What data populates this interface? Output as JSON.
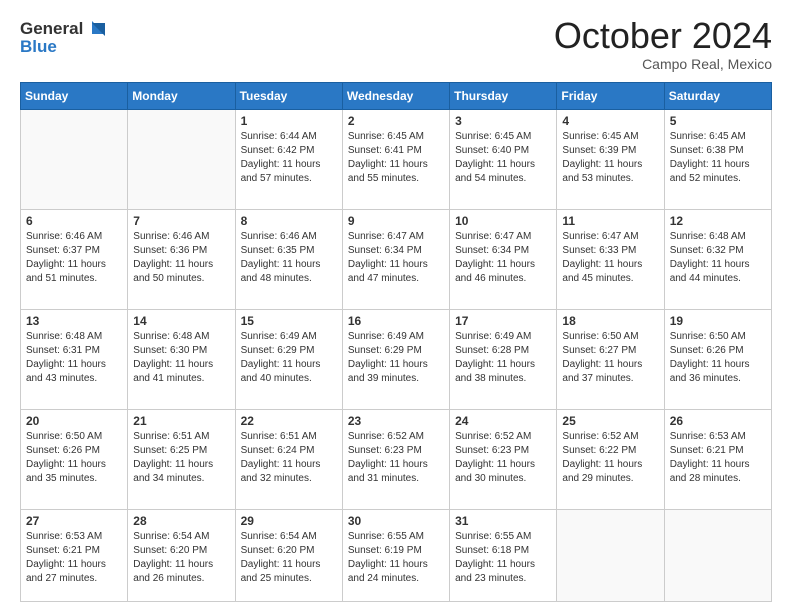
{
  "header": {
    "logo_line1": "General",
    "logo_line2": "Blue",
    "month_title": "October 2024",
    "location": "Campo Real, Mexico"
  },
  "weekdays": [
    "Sunday",
    "Monday",
    "Tuesday",
    "Wednesday",
    "Thursday",
    "Friday",
    "Saturday"
  ],
  "weeks": [
    [
      {
        "day": "",
        "info": ""
      },
      {
        "day": "",
        "info": ""
      },
      {
        "day": "1",
        "info": "Sunrise: 6:44 AM\nSunset: 6:42 PM\nDaylight: 11 hours and 57 minutes."
      },
      {
        "day": "2",
        "info": "Sunrise: 6:45 AM\nSunset: 6:41 PM\nDaylight: 11 hours and 55 minutes."
      },
      {
        "day": "3",
        "info": "Sunrise: 6:45 AM\nSunset: 6:40 PM\nDaylight: 11 hours and 54 minutes."
      },
      {
        "day": "4",
        "info": "Sunrise: 6:45 AM\nSunset: 6:39 PM\nDaylight: 11 hours and 53 minutes."
      },
      {
        "day": "5",
        "info": "Sunrise: 6:45 AM\nSunset: 6:38 PM\nDaylight: 11 hours and 52 minutes."
      }
    ],
    [
      {
        "day": "6",
        "info": "Sunrise: 6:46 AM\nSunset: 6:37 PM\nDaylight: 11 hours and 51 minutes."
      },
      {
        "day": "7",
        "info": "Sunrise: 6:46 AM\nSunset: 6:36 PM\nDaylight: 11 hours and 50 minutes."
      },
      {
        "day": "8",
        "info": "Sunrise: 6:46 AM\nSunset: 6:35 PM\nDaylight: 11 hours and 48 minutes."
      },
      {
        "day": "9",
        "info": "Sunrise: 6:47 AM\nSunset: 6:34 PM\nDaylight: 11 hours and 47 minutes."
      },
      {
        "day": "10",
        "info": "Sunrise: 6:47 AM\nSunset: 6:34 PM\nDaylight: 11 hours and 46 minutes."
      },
      {
        "day": "11",
        "info": "Sunrise: 6:47 AM\nSunset: 6:33 PM\nDaylight: 11 hours and 45 minutes."
      },
      {
        "day": "12",
        "info": "Sunrise: 6:48 AM\nSunset: 6:32 PM\nDaylight: 11 hours and 44 minutes."
      }
    ],
    [
      {
        "day": "13",
        "info": "Sunrise: 6:48 AM\nSunset: 6:31 PM\nDaylight: 11 hours and 43 minutes."
      },
      {
        "day": "14",
        "info": "Sunrise: 6:48 AM\nSunset: 6:30 PM\nDaylight: 11 hours and 41 minutes."
      },
      {
        "day": "15",
        "info": "Sunrise: 6:49 AM\nSunset: 6:29 PM\nDaylight: 11 hours and 40 minutes."
      },
      {
        "day": "16",
        "info": "Sunrise: 6:49 AM\nSunset: 6:29 PM\nDaylight: 11 hours and 39 minutes."
      },
      {
        "day": "17",
        "info": "Sunrise: 6:49 AM\nSunset: 6:28 PM\nDaylight: 11 hours and 38 minutes."
      },
      {
        "day": "18",
        "info": "Sunrise: 6:50 AM\nSunset: 6:27 PM\nDaylight: 11 hours and 37 minutes."
      },
      {
        "day": "19",
        "info": "Sunrise: 6:50 AM\nSunset: 6:26 PM\nDaylight: 11 hours and 36 minutes."
      }
    ],
    [
      {
        "day": "20",
        "info": "Sunrise: 6:50 AM\nSunset: 6:26 PM\nDaylight: 11 hours and 35 minutes."
      },
      {
        "day": "21",
        "info": "Sunrise: 6:51 AM\nSunset: 6:25 PM\nDaylight: 11 hours and 34 minutes."
      },
      {
        "day": "22",
        "info": "Sunrise: 6:51 AM\nSunset: 6:24 PM\nDaylight: 11 hours and 32 minutes."
      },
      {
        "day": "23",
        "info": "Sunrise: 6:52 AM\nSunset: 6:23 PM\nDaylight: 11 hours and 31 minutes."
      },
      {
        "day": "24",
        "info": "Sunrise: 6:52 AM\nSunset: 6:23 PM\nDaylight: 11 hours and 30 minutes."
      },
      {
        "day": "25",
        "info": "Sunrise: 6:52 AM\nSunset: 6:22 PM\nDaylight: 11 hours and 29 minutes."
      },
      {
        "day": "26",
        "info": "Sunrise: 6:53 AM\nSunset: 6:21 PM\nDaylight: 11 hours and 28 minutes."
      }
    ],
    [
      {
        "day": "27",
        "info": "Sunrise: 6:53 AM\nSunset: 6:21 PM\nDaylight: 11 hours and 27 minutes."
      },
      {
        "day": "28",
        "info": "Sunrise: 6:54 AM\nSunset: 6:20 PM\nDaylight: 11 hours and 26 minutes."
      },
      {
        "day": "29",
        "info": "Sunrise: 6:54 AM\nSunset: 6:20 PM\nDaylight: 11 hours and 25 minutes."
      },
      {
        "day": "30",
        "info": "Sunrise: 6:55 AM\nSunset: 6:19 PM\nDaylight: 11 hours and 24 minutes."
      },
      {
        "day": "31",
        "info": "Sunrise: 6:55 AM\nSunset: 6:18 PM\nDaylight: 11 hours and 23 minutes."
      },
      {
        "day": "",
        "info": ""
      },
      {
        "day": "",
        "info": ""
      }
    ]
  ]
}
